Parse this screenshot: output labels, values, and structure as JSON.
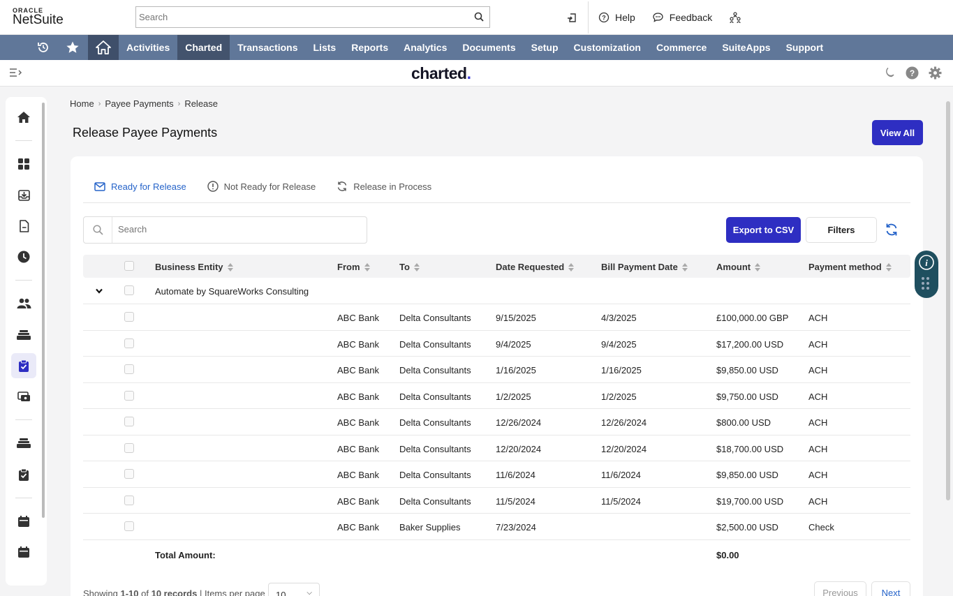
{
  "ns_header": {
    "logo_top": "ORACLE",
    "logo_bottom": "NetSuite",
    "search_placeholder": "Search",
    "help": "Help",
    "feedback": "Feedback"
  },
  "nav": {
    "items": [
      "Activities",
      "Charted",
      "Transactions",
      "Lists",
      "Reports",
      "Analytics",
      "Documents",
      "Setup",
      "Customization",
      "Commerce",
      "SuiteApps",
      "Support"
    ],
    "active": "Charted"
  },
  "charted_header": {
    "logo": "charted",
    "logo_dot": "."
  },
  "breadcrumb": [
    "Home",
    "Payee Payments",
    "Release"
  ],
  "page_title": "Release Payee Payments",
  "view_all": "View All",
  "tabs": [
    {
      "label": "Ready for Release",
      "icon": "mail-icon",
      "active": true
    },
    {
      "label": "Not Ready for Release",
      "icon": "alert-circle-icon",
      "active": false
    },
    {
      "label": "Release in Process",
      "icon": "refresh-icon",
      "active": false
    }
  ],
  "search_placeholder": "Search",
  "export_label": "Export to CSV",
  "filters_label": "Filters",
  "columns": [
    "Business Entity",
    "From",
    "To",
    "Date Requested",
    "Bill Payment Date",
    "Amount",
    "Payment method"
  ],
  "group_name": "Automate by SquareWorks Consulting",
  "rows": [
    {
      "from": "ABC Bank",
      "to": "Delta Consultants",
      "date_requested": "9/15/2025",
      "bill_date": "4/3/2025",
      "amount": "£100,000.00 GBP",
      "method": "ACH"
    },
    {
      "from": "ABC Bank",
      "to": "Delta Consultants",
      "date_requested": "9/4/2025",
      "bill_date": "9/4/2025",
      "amount": "$17,200.00 USD",
      "method": "ACH"
    },
    {
      "from": "ABC Bank",
      "to": "Delta Consultants",
      "date_requested": "1/16/2025",
      "bill_date": "1/16/2025",
      "amount": "$9,850.00 USD",
      "method": "ACH"
    },
    {
      "from": "ABC Bank",
      "to": "Delta Consultants",
      "date_requested": "1/2/2025",
      "bill_date": "1/2/2025",
      "amount": "$9,750.00 USD",
      "method": "ACH"
    },
    {
      "from": "ABC Bank",
      "to": "Delta Consultants",
      "date_requested": "12/26/2024",
      "bill_date": "12/26/2024",
      "amount": "$800.00 USD",
      "method": "ACH"
    },
    {
      "from": "ABC Bank",
      "to": "Delta Consultants",
      "date_requested": "12/20/2024",
      "bill_date": "12/20/2024",
      "amount": "$18,700.00 USD",
      "method": "ACH"
    },
    {
      "from": "ABC Bank",
      "to": "Delta Consultants",
      "date_requested": "11/6/2024",
      "bill_date": "11/6/2024",
      "amount": "$9,850.00 USD",
      "method": "ACH"
    },
    {
      "from": "ABC Bank",
      "to": "Delta Consultants",
      "date_requested": "11/5/2024",
      "bill_date": "11/5/2024",
      "amount": "$19,700.00 USD",
      "method": "ACH"
    },
    {
      "from": "ABC Bank",
      "to": "Baker Supplies",
      "date_requested": "7/23/2024",
      "bill_date": "",
      "amount": "$2,500.00 USD",
      "method": "Check"
    }
  ],
  "total_label": "Total Amount:",
  "total_value": "$0.00",
  "footer": {
    "showing_prefix": "Showing ",
    "showing_range": "1-10",
    "showing_of": " of ",
    "showing_count": "10 records",
    "items_per_page": "Items per page",
    "per_page_value": "10",
    "previous": "Previous",
    "next": "Next"
  },
  "colors": {
    "accent": "#2e2ec2",
    "nav_bg": "#607799",
    "link_blue": "#2563c9",
    "widget": "#1f4f5f"
  }
}
